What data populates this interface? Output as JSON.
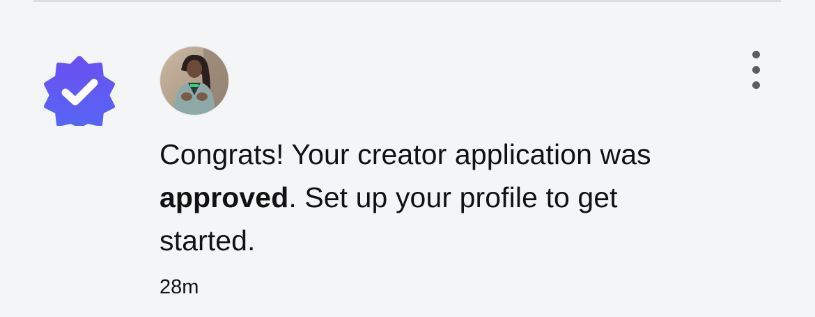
{
  "notification": {
    "badge_icon": "verified-check-badge-icon",
    "badge_color": "#5b4df0",
    "avatar_icon": "user-avatar-photo",
    "menu_icon": "vertical-ellipsis-icon",
    "message_part1": "Congrats! Your creator application was ",
    "message_bold": "approved",
    "message_part2": ". Set up your profile to get started.",
    "timestamp": "28m"
  }
}
